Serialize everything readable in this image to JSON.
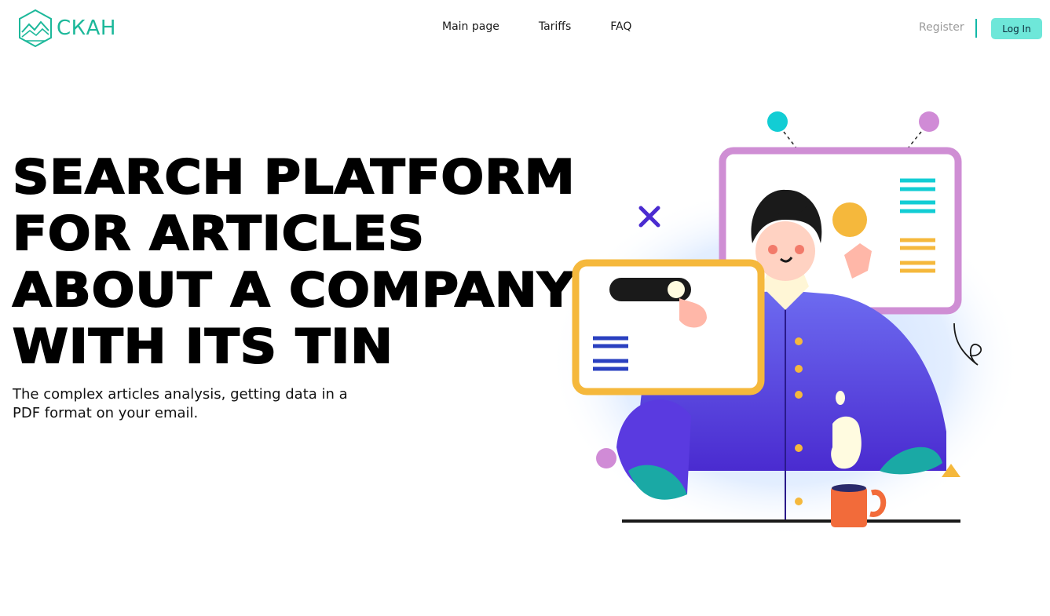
{
  "header": {
    "logo_text": "СКАН",
    "nav": [
      {
        "label": "Main page"
      },
      {
        "label": "Tariffs"
      },
      {
        "label": "FAQ"
      }
    ],
    "register_label": "Register",
    "login_label": "Log In"
  },
  "hero": {
    "title_lines": [
      "SEARCH PLATFORM",
      "FOR ARTICLES",
      "ABOUT A COMPANY",
      "WITH ITS TIN"
    ],
    "subtitle": "The complex articles analysis, getting data in a PDF format on your email."
  },
  "colors": {
    "brand": "#1cb89a",
    "login_bg": "#6ee7d9",
    "divider": "#12b8a8",
    "register_text": "#9a9a9a"
  },
  "icons": {
    "logo": "hexagon-mountains-icon",
    "illustration": "person-with-ui-cards-illustration"
  }
}
